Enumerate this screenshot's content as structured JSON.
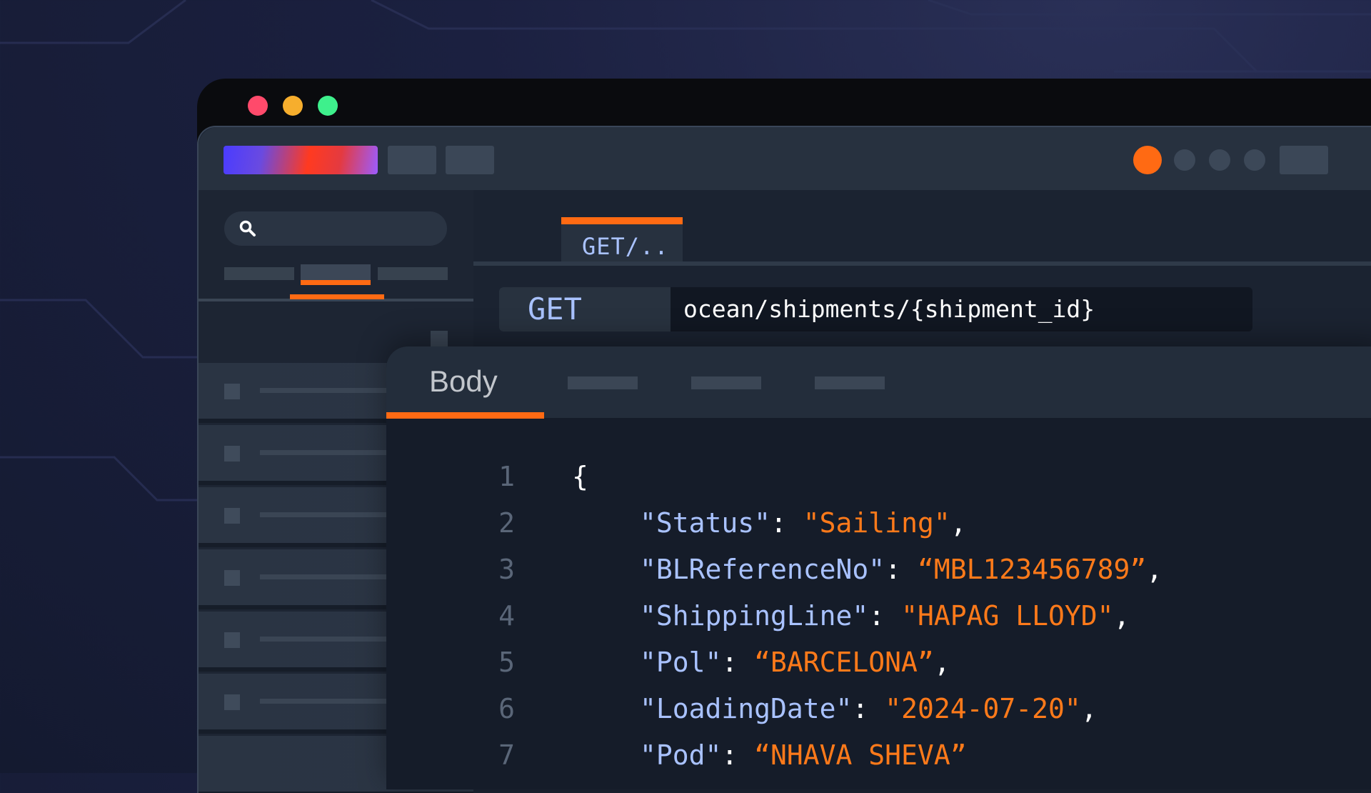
{
  "window": {
    "traffic_lights": [
      "close",
      "minimize",
      "zoom"
    ]
  },
  "colors": {
    "accent": "#ff6a13",
    "key": "#a9c2ff",
    "value": "#ff7a1a"
  },
  "request_tab": {
    "label": "GET/.."
  },
  "request": {
    "method": "GET",
    "url": "ocean/shipments/{shipment_id}"
  },
  "panel": {
    "active_tab": "Body"
  },
  "code": {
    "open_brace": "{",
    "lines": [
      {
        "num": "1"
      },
      {
        "num": "2",
        "key": "\"Status\"",
        "sep": ": ",
        "value": "\"Sailing\"",
        "end": ","
      },
      {
        "num": "3",
        "key": "\"BLReferenceNo\"",
        "sep": ": ",
        "value": "“MBL123456789”",
        "end": ","
      },
      {
        "num": "4",
        "key": "\"ShippingLine\"",
        "sep": ": ",
        "value": "\"HAPAG LLOYD\"",
        "end": ","
      },
      {
        "num": "5",
        "key": "\"Pol\"",
        "sep": ": ",
        "value": "“BARCELONA”",
        "end": ","
      },
      {
        "num": "6",
        "key": "\"LoadingDate\"",
        "sep": ": ",
        "value": "\"2024-07-20\"",
        "end": ","
      },
      {
        "num": "7",
        "key": "\"Pod\"",
        "sep": ": ",
        "value": "“NHAVA SHEVA”",
        "end": ""
      }
    ]
  }
}
